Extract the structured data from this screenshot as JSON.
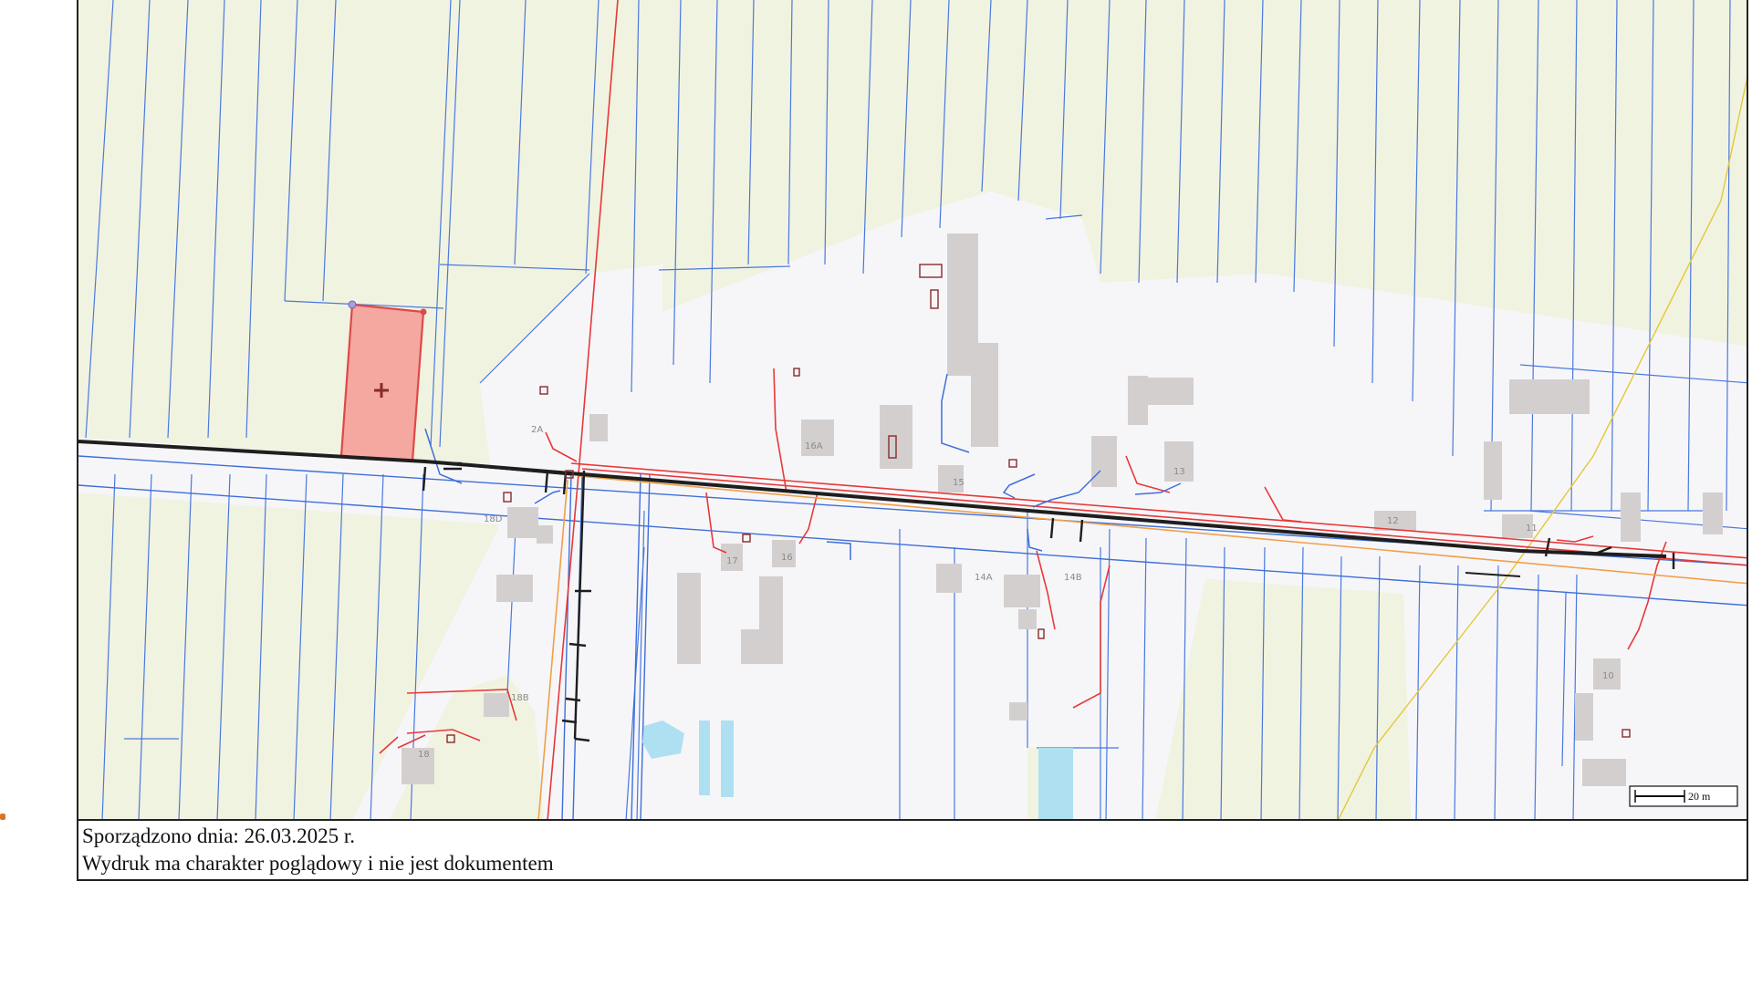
{
  "map": {
    "address_labels": [
      "2A",
      "16A",
      "15",
      "13",
      "18D",
      "17",
      "16",
      "14A",
      "14B",
      "12",
      "11",
      "18B",
      "18",
      "10"
    ],
    "scale_label": "20 m",
    "colors": {
      "background": "#f1f3e1",
      "roads": "#f6f6f9",
      "parcel_lines": "#3e6fd8",
      "power_lines": "#e83838",
      "gas_line": "#f0a048",
      "main_line": "#1e1e1e",
      "buildings": "#d4cfcf",
      "water": "#aee0f1",
      "highlight_parcel": "#f4a8a0",
      "boundary_yellow": "#e4c83a"
    }
  },
  "caption": {
    "date_line": "Sporządzono dnia: 26.03.2025 r.",
    "disclaimer": "Wydruk ma charakter poglądowy i nie jest dokumentem"
  }
}
